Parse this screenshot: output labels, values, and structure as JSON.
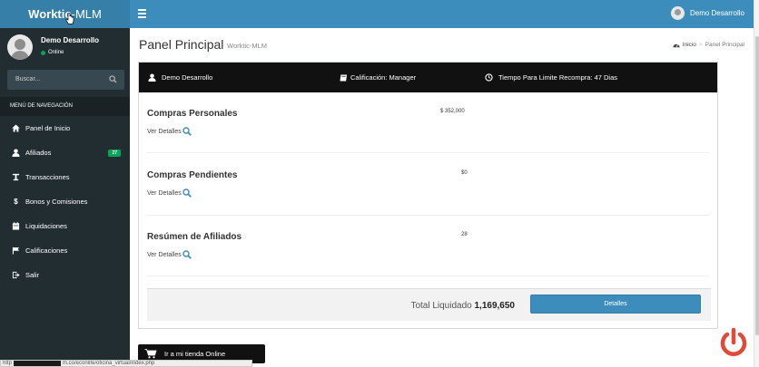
{
  "brand": {
    "part1": "Worktic",
    "part2": "-MLM"
  },
  "top_user": {
    "name": "Demo Desarrollo"
  },
  "sidebar": {
    "user_name": "Demo Desarrollo",
    "status": "Online",
    "search_placeholder": "Buscar...",
    "nav_header": "MENÚ DE NAVEGACIÓN",
    "items": [
      {
        "label": "Panel de Inicio",
        "icon": "home-icon"
      },
      {
        "label": "Afiliados",
        "icon": "user-icon",
        "badge": "27"
      },
      {
        "label": "Transacciones",
        "icon": "transactions-icon"
      },
      {
        "label": "Bonos y Comisiones",
        "icon": "dollar-icon"
      },
      {
        "label": "Liquidaciones",
        "icon": "calendar-icon"
      },
      {
        "label": "Calificaciones",
        "icon": "flag-icon"
      },
      {
        "label": "Salir",
        "icon": "sign-out-icon"
      }
    ]
  },
  "page": {
    "title": "Panel Principal",
    "subtitle": "Worktic-MLM",
    "breadcrumb": {
      "home": "Inicio",
      "current": "Panel Principal"
    }
  },
  "summary": {
    "user": "Demo Desarrollo",
    "qualification": "Calificación: Manager",
    "repurchase": "Tiempo Para Limite Recompra: 47 Dias"
  },
  "rows": [
    {
      "label": "Compras Personales",
      "value": "$ 352,000",
      "link": "Ver Detalles"
    },
    {
      "label": "Compras Pendientes",
      "value": "$0",
      "link": "Ver Detalles"
    },
    {
      "label": "Resúmen de Afiliados",
      "value": "28",
      "link": "Ver Detalles"
    }
  ],
  "footer": {
    "total_label": "Total Liquidado",
    "total_value": "1,169,650",
    "button": "Detalles"
  },
  "store_button": "Ir a mi tienda Online",
  "status_bar": {
    "prefix": "http",
    "url": "m.co/econlife/oficina_virtual/index.php"
  },
  "colors": {
    "header": "#3c8dbc",
    "brand": "#367fa9",
    "sidebar": "#222d32",
    "badge": "#00a65a",
    "power": "#dd4b39"
  }
}
